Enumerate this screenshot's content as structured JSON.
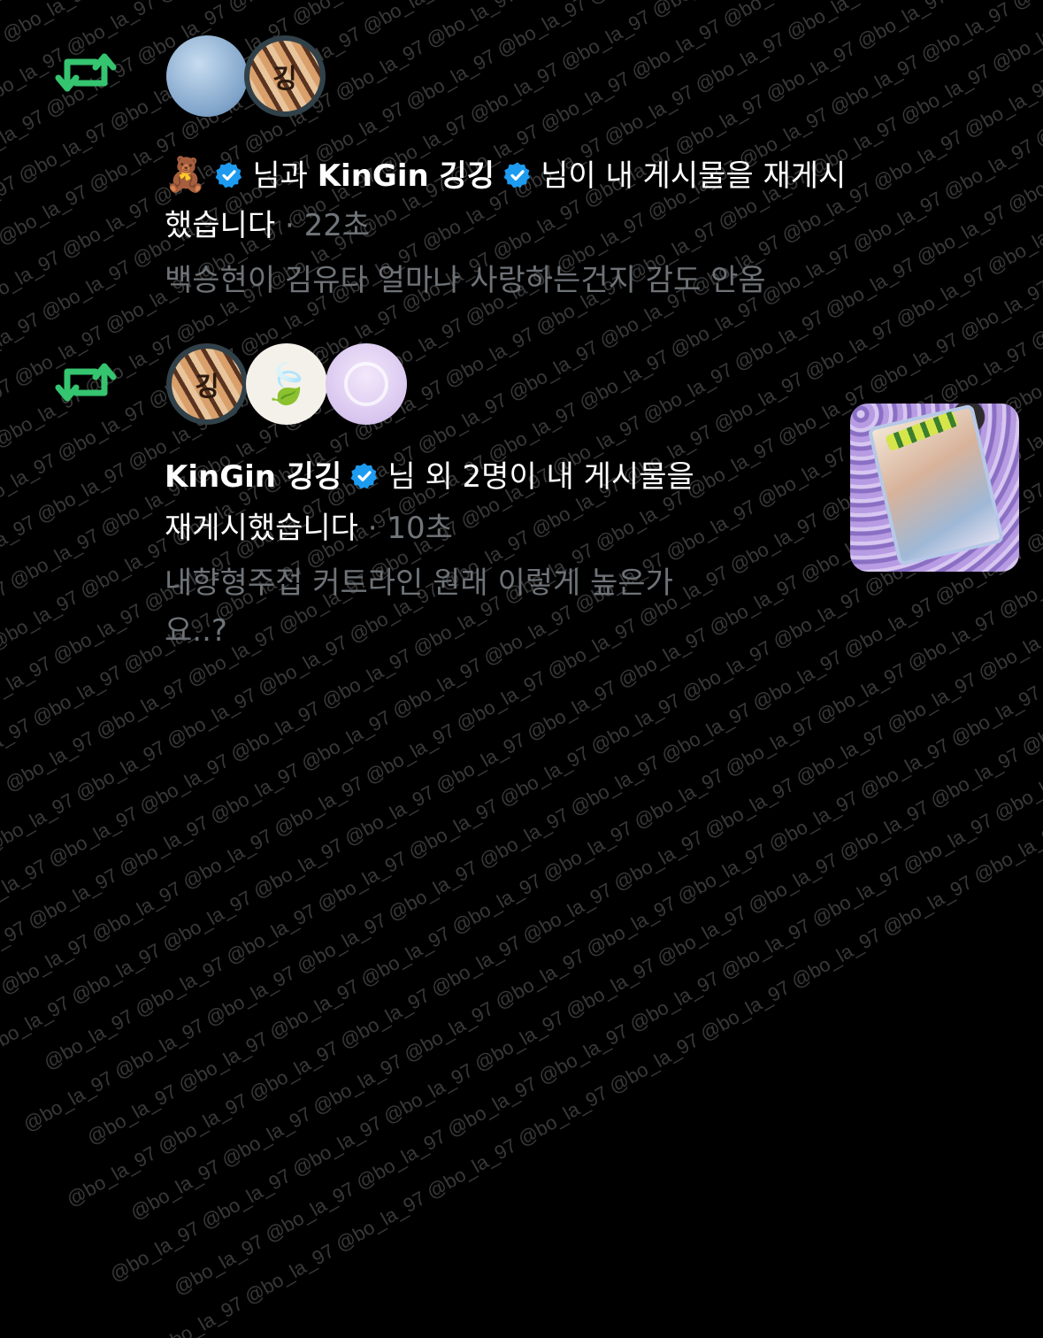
{
  "watermark_text": "@bo_la_97",
  "colors": {
    "repost_green": "#35c46f",
    "verified_blue": "#1d9bf0",
    "muted_text": "#71767b"
  },
  "notifications": [
    {
      "icon": "repost-icon",
      "avatars": [
        "avatar-blue-swirl",
        "avatar-tiger-gang"
      ],
      "actor1_emoji": "🧸",
      "connector1": "님과",
      "actor2": "KinGin 깅깅",
      "line1_rest": "님이 내 게시물을 재게시",
      "line2_action": "했습니다",
      "separator": "·",
      "time": "22초",
      "preview": "백승현이 김유타 얼마나 사랑하는건지 감도 안옴"
    },
    {
      "icon": "repost-icon",
      "avatars": [
        "avatar-tiger-gang",
        "avatar-tea-leaf",
        "avatar-lilac"
      ],
      "actor": "KinGin 깅깅",
      "line1_rest": "님 외 2명이 내 게시물을",
      "line2_action": "재게시했습니다",
      "separator": "·",
      "time": "10초",
      "preview_line1": "내향형주접 커트라인 원래 이렇게 높은가",
      "preview_line2": "요..?",
      "thumbnail": "post-thumbnail-image"
    }
  ],
  "avatar_glyphs": {
    "tiger": "깅",
    "leaf": "🍃"
  }
}
